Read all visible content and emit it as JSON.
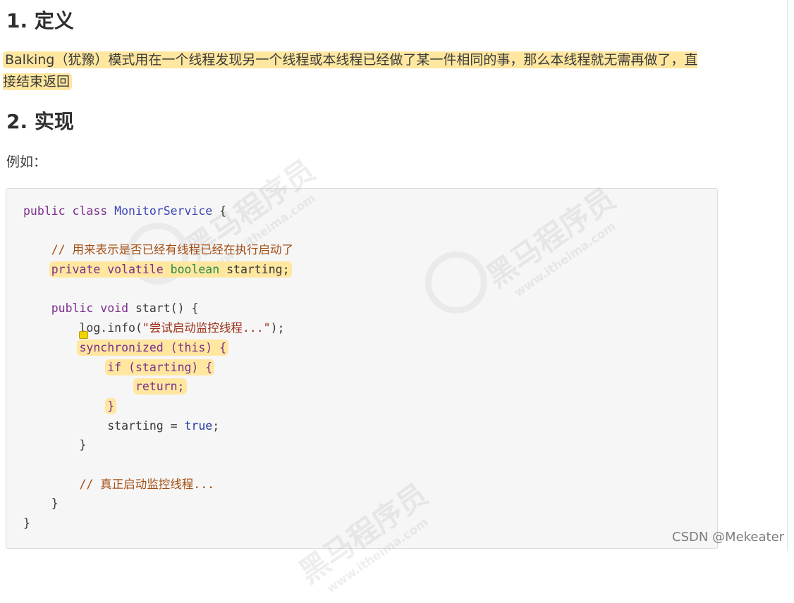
{
  "section1": {
    "heading": "1. 定义",
    "paragraph": "Balking（犹豫）模式用在一个线程发现另一个线程或本线程已经做了某一件相同的事，那么本线程就无需再做了，直接结束返回"
  },
  "section2": {
    "heading": "2. 实现",
    "example_label": "例如："
  },
  "code": {
    "l1_kw": "public class",
    "l1_cls": "MonitorService",
    "l1_rest": "{",
    "l3_cmt": "// 用来表示是否已经有线程已经在执行启动了",
    "l4_kw": "private volatile",
    "l4_typ": "boolean",
    "l4_rest": "starting;",
    "l6_kw": "public void",
    "l6_rest": "start() {",
    "l7_pre": "log.info(",
    "l7_str": "\"尝试启动监控线程...\"",
    "l7_post": ");",
    "l8_kw": "synchronized",
    "l8_rest": "(this) {",
    "l9_kw": "if",
    "l9_rest": "(starting) {",
    "l10_kw": "return;",
    "l11": "}",
    "l12_pre": "starting =",
    "l12_val": "true",
    "l12_post": ";",
    "l13": "}",
    "l15_cmt": "// 真正启动监控线程...",
    "l16": "}",
    "l17": "}"
  },
  "watermark": {
    "brand": "黑马程序员",
    "url": "www.itheima.com"
  },
  "footer": "CSDN @Mekeater"
}
